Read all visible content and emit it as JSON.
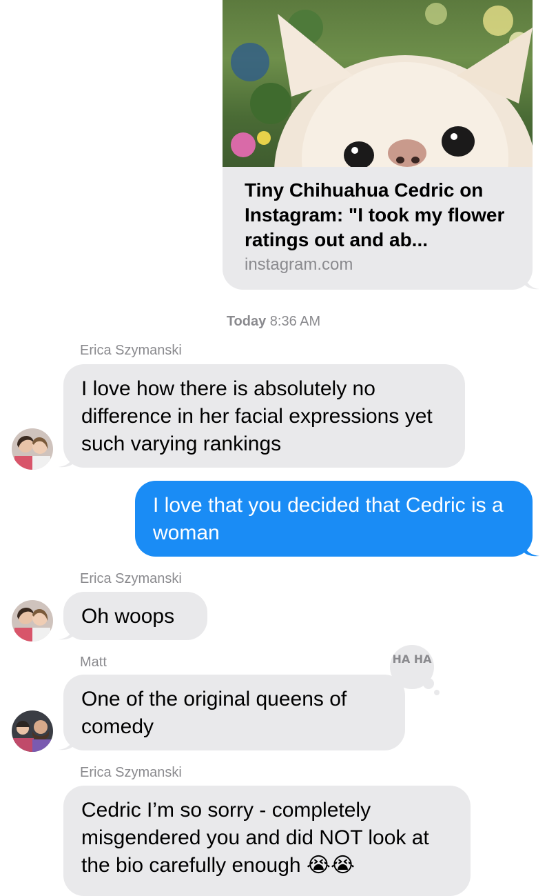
{
  "link_preview": {
    "title": "Tiny Chihuahua Cedric on Instagram: \"I took my flower ratings out and ab...",
    "domain": "instagram.com",
    "image_icon": "chihuahua-photo"
  },
  "timestamp": {
    "day": "Today",
    "time": "8:36 AM"
  },
  "messages": [
    {
      "sender": "Erica Szymanski",
      "text": "I love how there is absolutely no difference in her facial expressions yet such varying rankings"
    },
    {
      "text": "I love that you decided that Cedric is a woman"
    },
    {
      "sender": "Erica Szymanski",
      "text": "Oh woops"
    },
    {
      "sender": "Matt",
      "text": "One of the original queens of comedy",
      "tapback": "HA HA"
    },
    {
      "sender": "Erica Szymanski",
      "text": "Cedric I’m so sorry - completely misgendered you and did NOT look at the bio carefully enough 😭😭"
    }
  ],
  "colors": {
    "incoming_bubble": "#e9e9eb",
    "outgoing_bubble": "#1a8cf5",
    "meta_text": "#8a8a8e"
  }
}
